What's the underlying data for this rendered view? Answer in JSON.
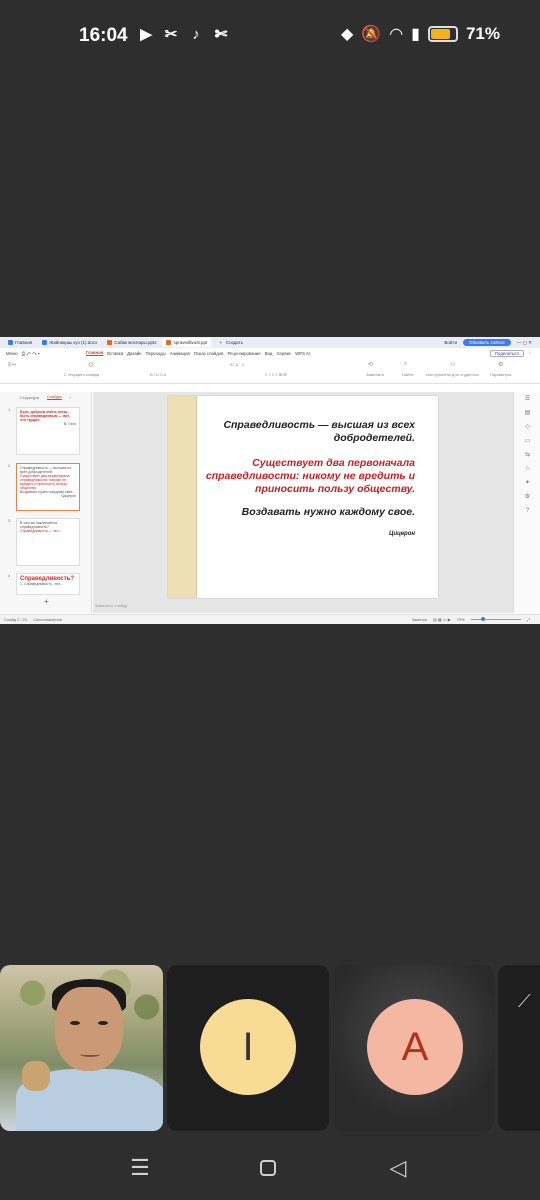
{
  "status_bar": {
    "time": "16:04",
    "battery": "71%",
    "battery_level": 0.71,
    "app_icons": [
      "youtube-icon",
      "capcut-icon",
      "tiktok-icon",
      "scissors-icon"
    ],
    "system_icons": [
      "drop-icon",
      "mute-icon",
      "wifi-icon",
      "signal-icon"
    ]
  },
  "wps": {
    "tabs": [
      {
        "label": "Главная",
        "color": "#3d7be8"
      },
      {
        "label": "Жайнақшы куз (1).docx",
        "color": "#3d7be8"
      },
      {
        "label": "Сабак жоспары.pptx",
        "color": "#e2692c"
      },
      {
        "label": "spravedlivost.ppt",
        "color": "#e2692c"
      }
    ],
    "new_tab": "+",
    "create": "Создать",
    "login": "Войти",
    "update_button": "Обновить сейчас",
    "menu": [
      "Меню",
      "Главная",
      "Вставка",
      "Дизайн",
      "Переходы",
      "Анимация",
      "Показ слайдов",
      "Рецензирование",
      "Вид",
      "Сервис",
      "WPS AI"
    ],
    "access": "Поделиться",
    "ribbon": {
      "new_slide": "С текущего слайда",
      "font": "Шрифт",
      "replace": "Заменить",
      "find": "Найти",
      "tools": "Инструменты для студентов",
      "params": "Параметры"
    },
    "left_panel": {
      "tab_structure": "Структура",
      "tab_slides": "Слайды",
      "thumbs": [
        {
          "num": "1",
          "text": "Быть добрым очень легко, быть справедливым — вот, что трудно.",
          "author": "В. Гюго"
        },
        {
          "num": "2",
          "text": "Справедливость — высшая из всех добродетелей.",
          "text2": "Существует два первоначала справедливости: никому не вредить и приносить пользу обществу.",
          "text3": "Воздавать нужно каждому свое.",
          "author": "Цицерон"
        },
        {
          "num": "3",
          "text": "В чем же заключается справедливость?",
          "text2": "Справедливость — это..."
        },
        {
          "num": "4",
          "text": "Справедливость?",
          "text2": "1. Справедливость - это..."
        }
      ],
      "add": "+"
    },
    "slide": {
      "quote1": "Справедливость — высшая из всех добродетелей.",
      "quote2": "Существует два первоначала справедливости: никому не вредить и приносить пользу обществу.",
      "quote3": "Воздавать нужно каждому свое.",
      "author": "Цицерон"
    },
    "notes_placeholder": "Заметки к слайду",
    "status": {
      "slide_info": "Слайд 2 / 21",
      "spell": "Сопоставление",
      "notes": "Заметки",
      "zoom": "79%"
    }
  },
  "participants": [
    {
      "type": "video",
      "name": "participant-video"
    },
    {
      "type": "avatar",
      "initial": "I",
      "color": "#f8dc95"
    },
    {
      "type": "avatar",
      "initial": "A",
      "color": "#f4b8a2"
    }
  ]
}
